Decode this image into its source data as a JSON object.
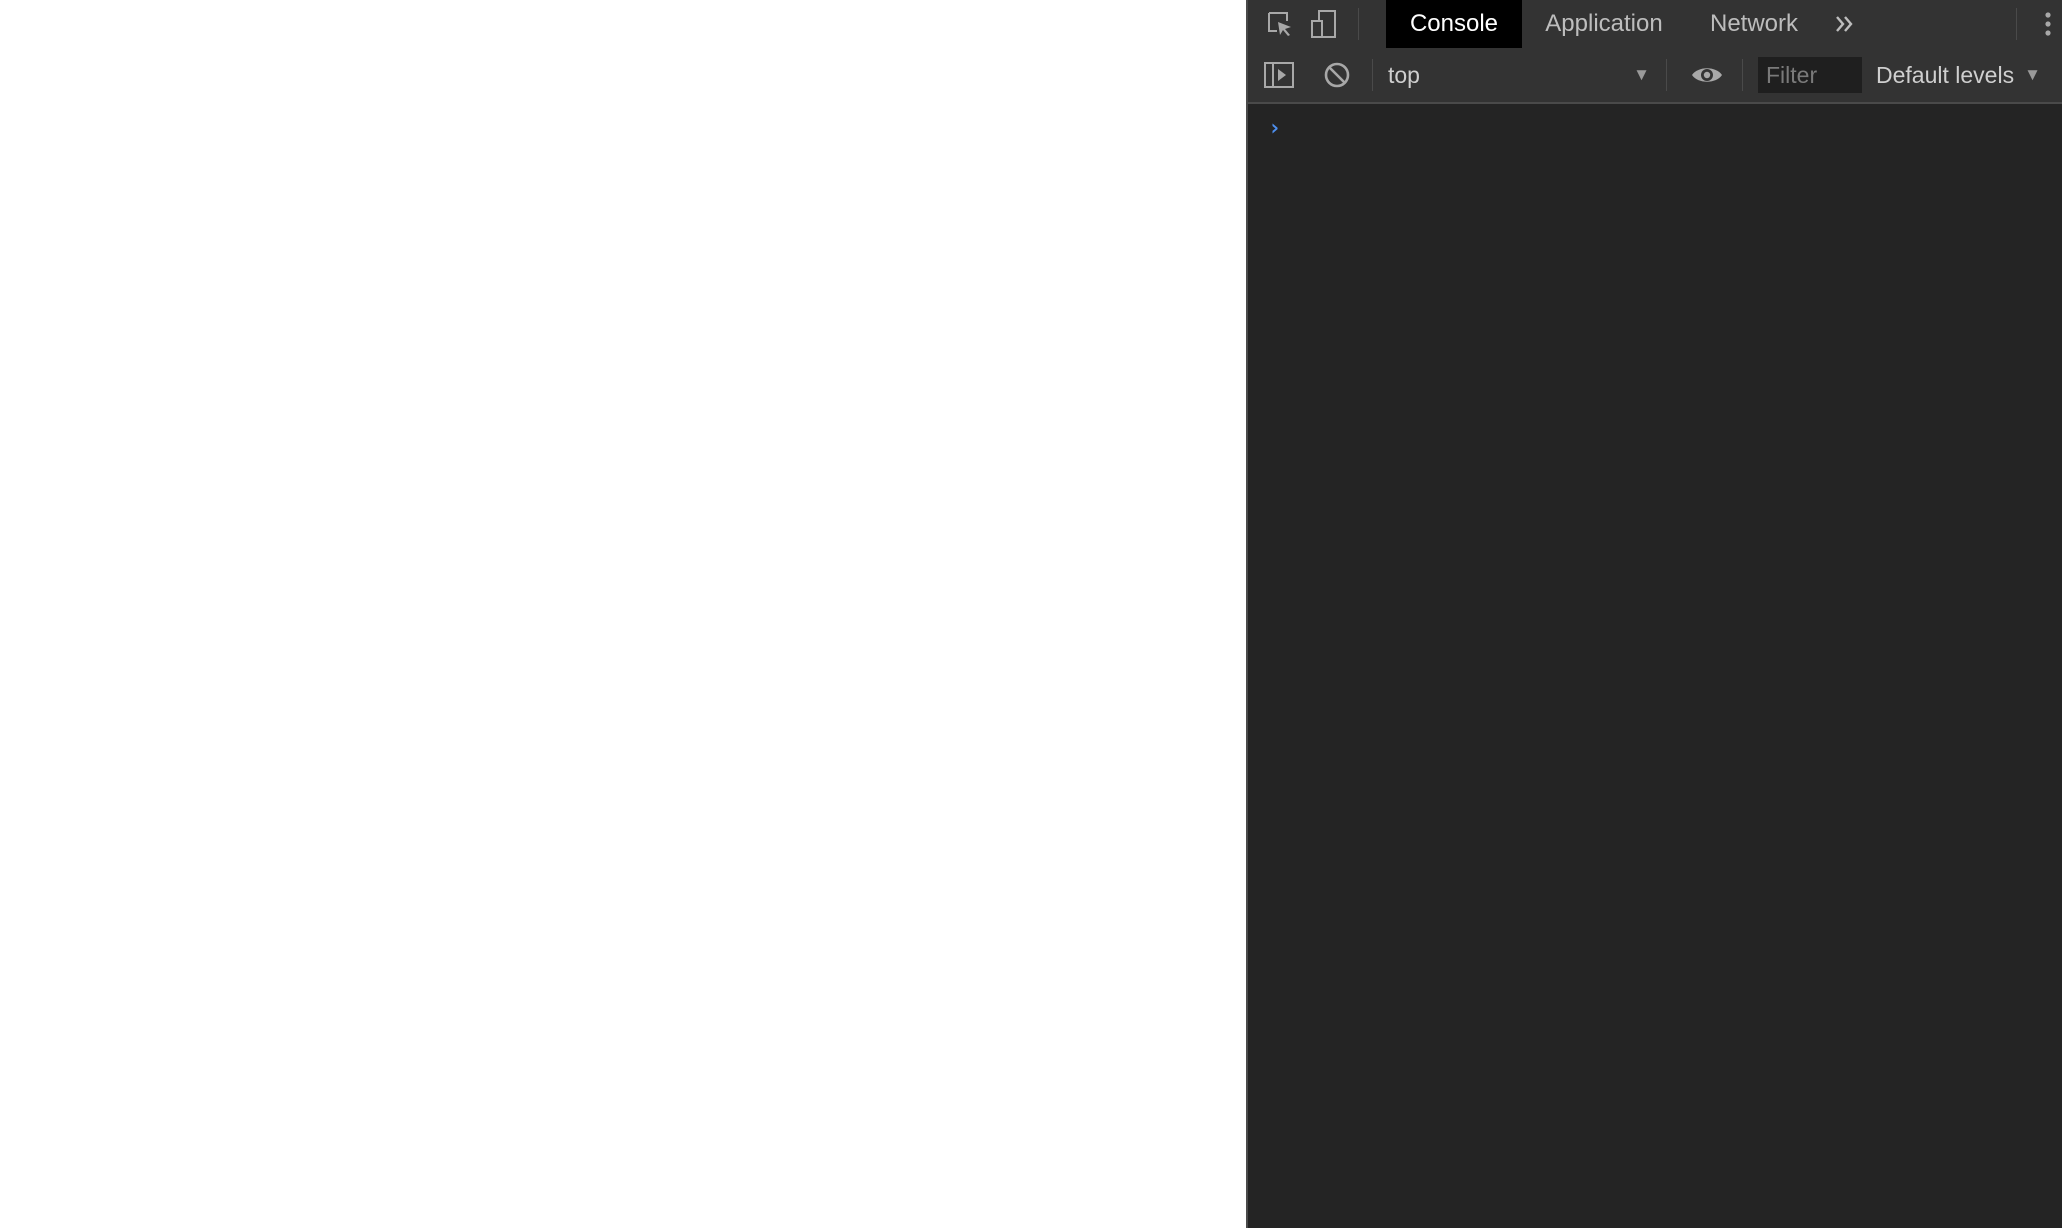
{
  "devtools": {
    "tabs": [
      {
        "label": "Console",
        "active": true
      },
      {
        "label": "Application",
        "active": false
      },
      {
        "label": "Network",
        "active": false
      }
    ],
    "icons": {
      "inspect": "inspect-element-icon",
      "device": "device-toolbar-icon",
      "more_tabs": "double-chevron-right-icon",
      "menu": "vertical-ellipsis-icon",
      "sidebar": "show-console-sidebar-icon",
      "clear": "clear-console-icon",
      "live_expression": "eye-icon"
    },
    "console_toolbar": {
      "context_value": "top",
      "filter_placeholder": "Filter",
      "levels_label": "Default levels"
    },
    "prompt_symbol": "›"
  },
  "colors": {
    "panel_bg": "#242424",
    "toolbar_bg": "#333333",
    "active_tab_bg": "#000000",
    "prompt_accent": "#4d8fef"
  }
}
